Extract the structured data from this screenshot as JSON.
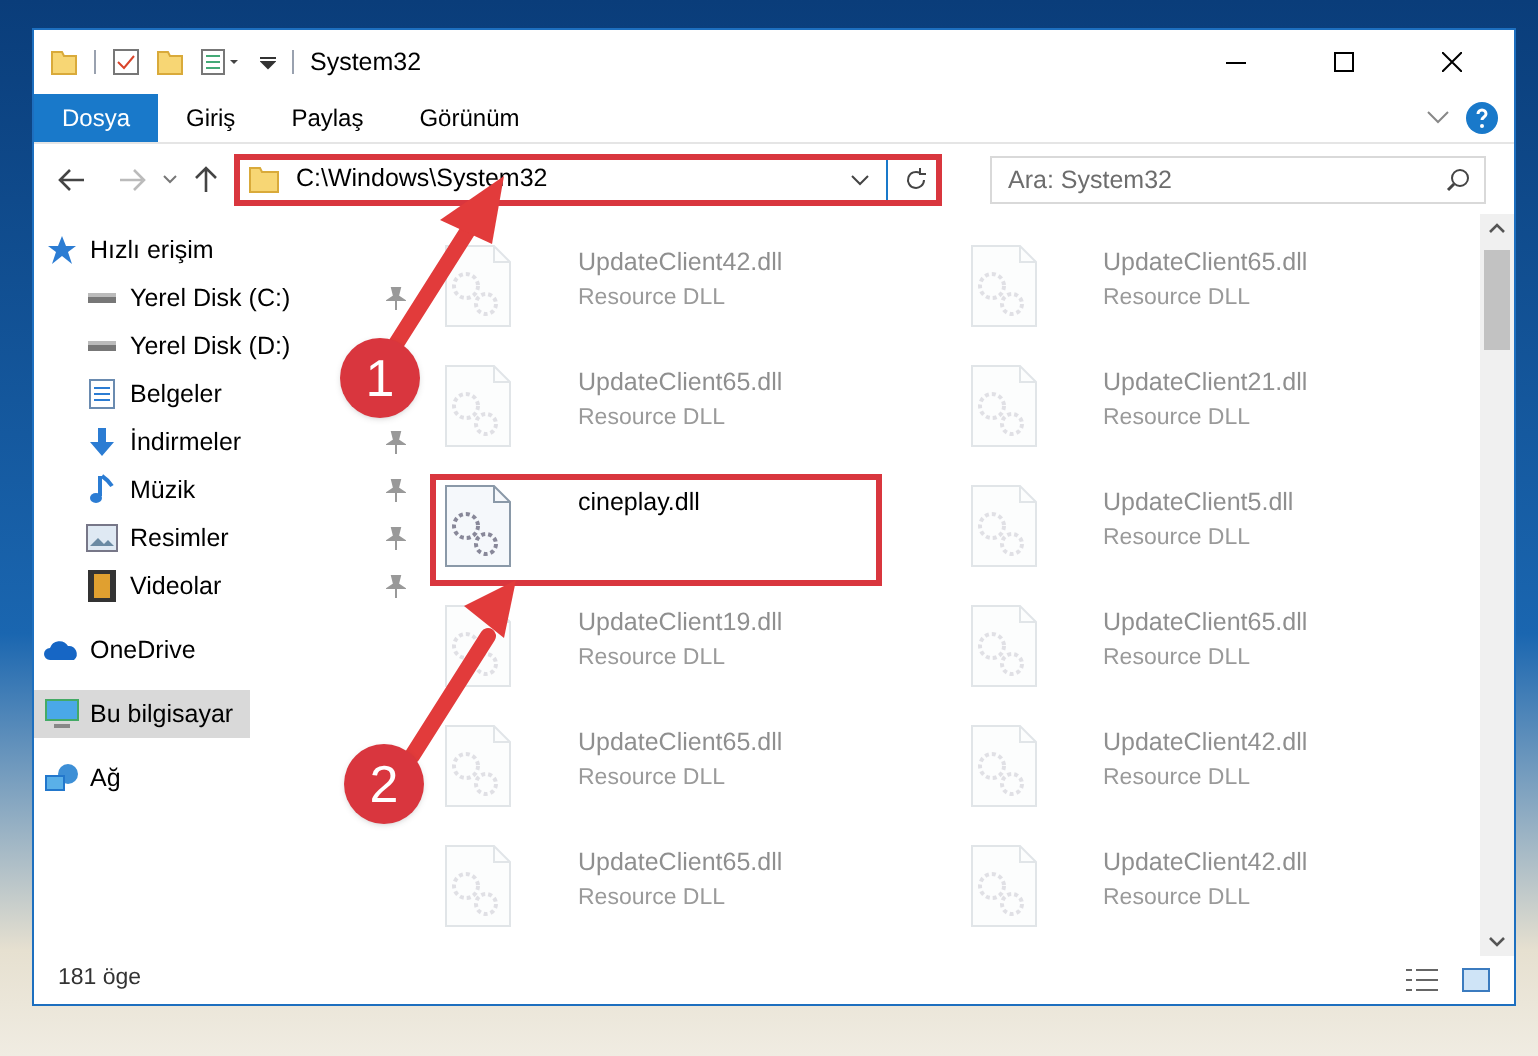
{
  "window": {
    "title": "System32"
  },
  "ribbon_tabs": [
    {
      "label": "Dosya",
      "selected": true
    },
    {
      "label": "Giriş",
      "selected": false
    },
    {
      "label": "Paylaş",
      "selected": false
    },
    {
      "label": "Görünüm",
      "selected": false
    }
  ],
  "address": {
    "value": "C:\\Windows\\System32",
    "highlighted": true
  },
  "search": {
    "placeholder": "Ara: System32"
  },
  "sidebar": {
    "items": [
      {
        "label": "Hızlı erişim",
        "kind": "star",
        "selected": false,
        "pinned": false,
        "children": [
          {
            "label": "Yerel Disk (C:)",
            "kind": "disk",
            "selected": false,
            "pinned": true
          },
          {
            "label": "Yerel Disk (D:)",
            "kind": "disk",
            "selected": false,
            "pinned": false
          },
          {
            "label": "Belgeler",
            "kind": "doc",
            "selected": false,
            "pinned": false
          },
          {
            "label": "İndirmeler",
            "kind": "download",
            "selected": false,
            "pinned": true
          },
          {
            "label": "Müzik",
            "kind": "music",
            "selected": false,
            "pinned": true
          },
          {
            "label": "Resimler",
            "kind": "picture",
            "selected": false,
            "pinned": true
          },
          {
            "label": "Videolar",
            "kind": "video",
            "selected": false,
            "pinned": true
          }
        ]
      },
      {
        "label": "OneDrive",
        "kind": "cloud",
        "selected": false,
        "pinned": false
      },
      {
        "label": "Bu bilgisayar",
        "kind": "pc",
        "selected": true,
        "pinned": false
      },
      {
        "label": "Ağ",
        "kind": "network",
        "selected": false,
        "pinned": false
      }
    ]
  },
  "files": [
    {
      "name": "UpdateClient42.dll",
      "type": "Resource DLL",
      "highlighted": false
    },
    {
      "name": "UpdateClient65.dll",
      "type": "Resource DLL",
      "highlighted": false
    },
    {
      "name": "UpdateClient65.dll",
      "type": "Resource DLL",
      "highlighted": false
    },
    {
      "name": "UpdateClient21.dll",
      "type": "Resource DLL",
      "highlighted": false
    },
    {
      "name": "cineplay.dll",
      "highlighted": true
    },
    {
      "name": "UpdateClient5.dll",
      "type": "Resource DLL",
      "highlighted": false
    },
    {
      "name": "UpdateClient19.dll",
      "type": "Resource DLL",
      "highlighted": false
    },
    {
      "name": "UpdateClient65.dll",
      "type": "Resource DLL",
      "highlighted": false
    },
    {
      "name": "UpdateClient65.dll",
      "type": "Resource DLL",
      "highlighted": false
    },
    {
      "name": "UpdateClient42.dll",
      "type": "Resource DLL",
      "highlighted": false
    },
    {
      "name": "UpdateClient65.dll",
      "type": "Resource DLL",
      "highlighted": false
    },
    {
      "name": "UpdateClient42.dll",
      "type": "Resource DLL",
      "highlighted": false
    }
  ],
  "status_bar": {
    "count": "181 öge"
  },
  "callouts": [
    {
      "number": "1"
    },
    {
      "number": "2"
    }
  ]
}
